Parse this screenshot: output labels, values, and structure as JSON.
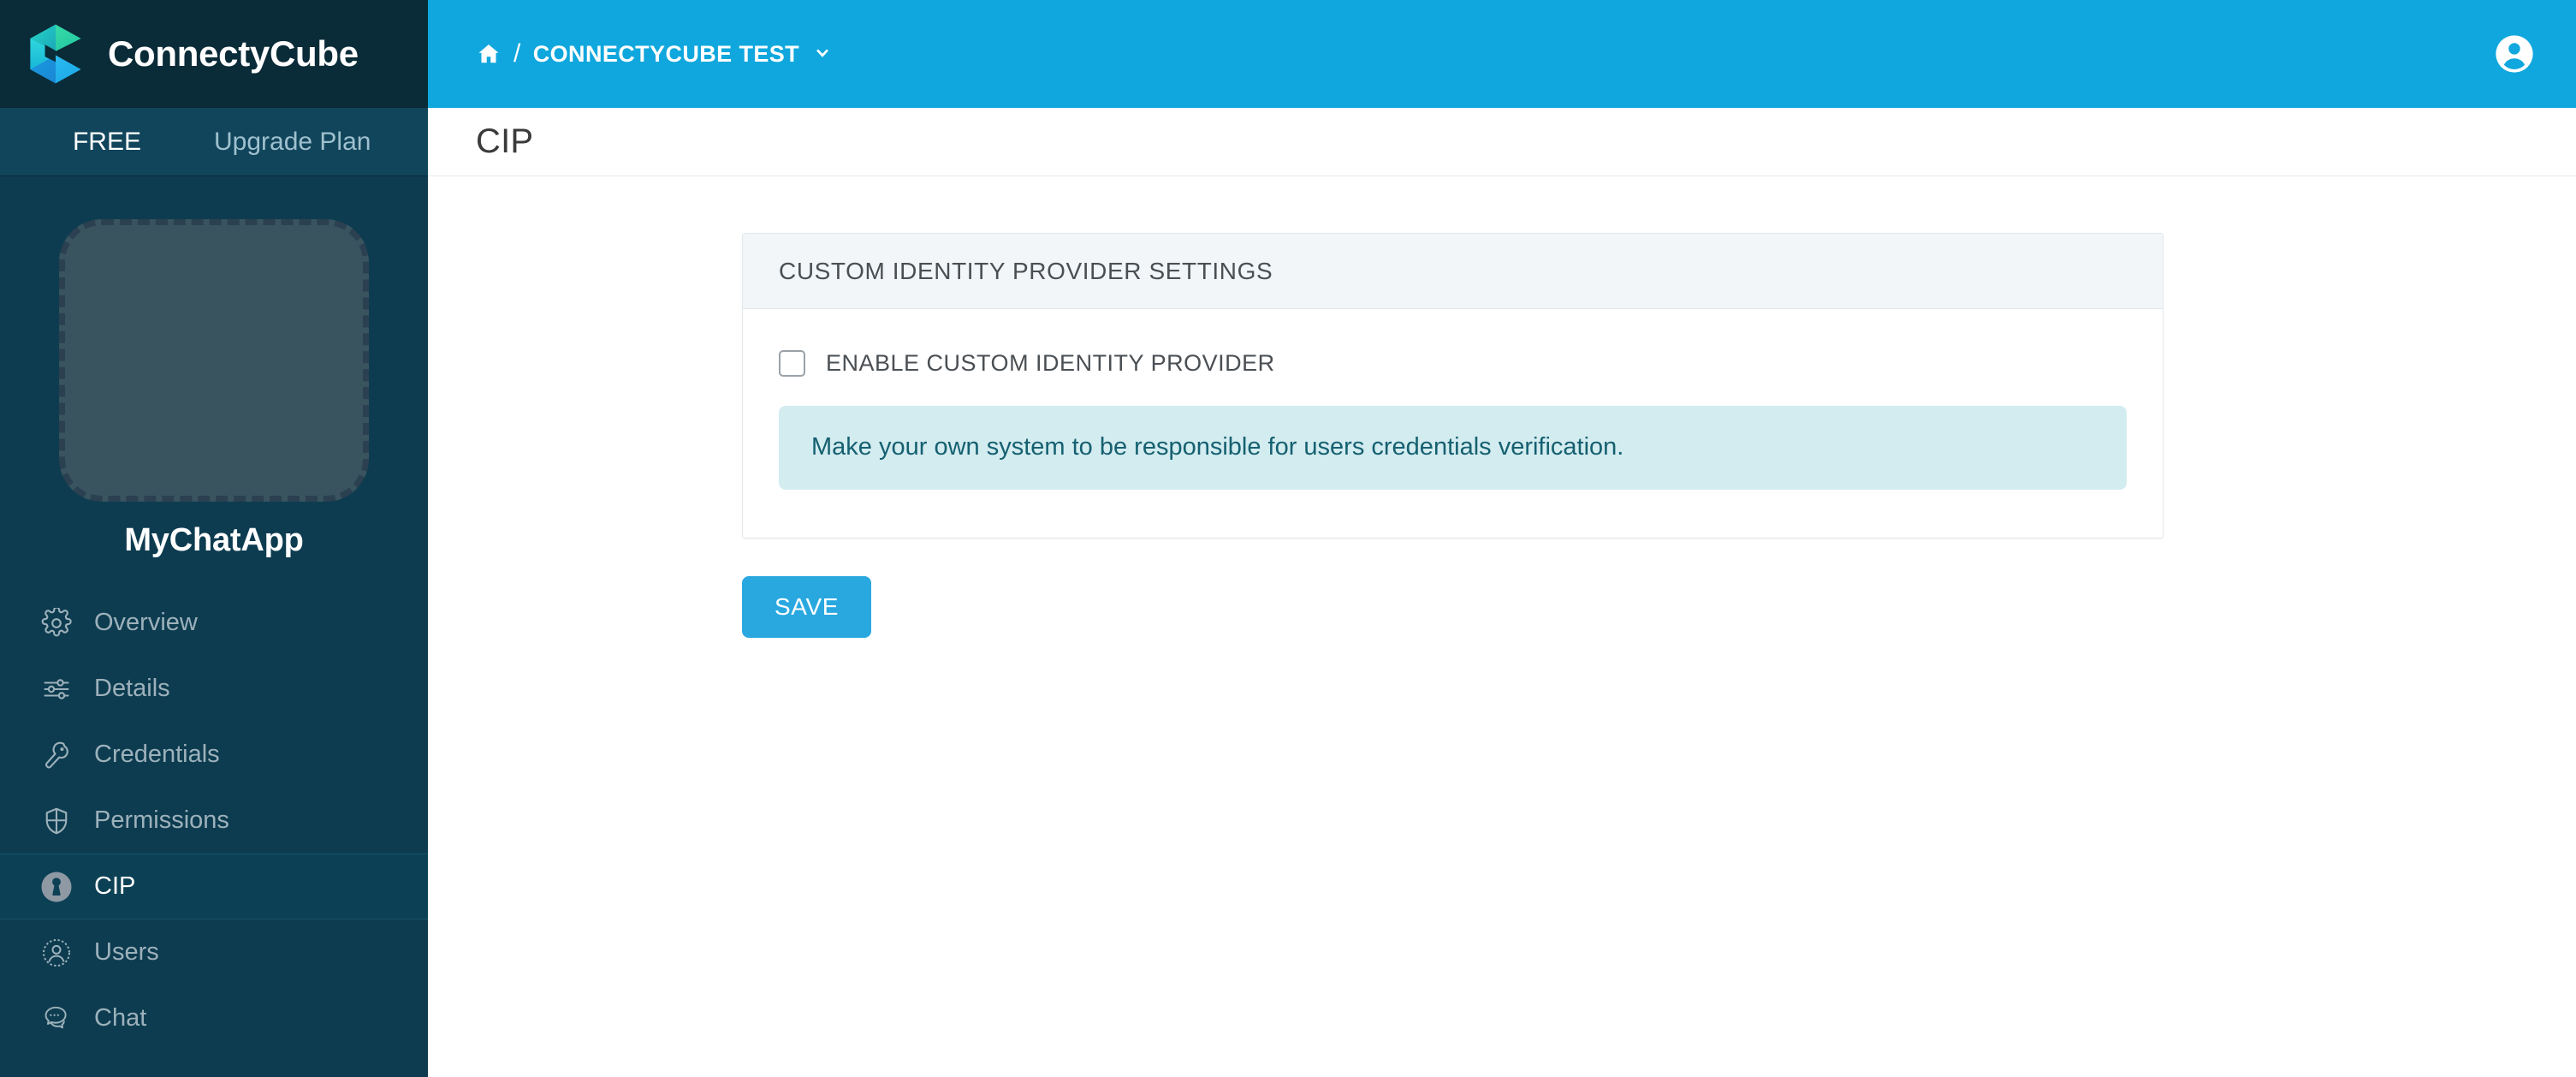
{
  "brand": {
    "name": "ConnectyCube",
    "logo_icon": "connectycube-cube-logo"
  },
  "plan": {
    "tier_label": "FREE",
    "upgrade_label": "Upgrade Plan"
  },
  "app": {
    "avatar_icon": "app-avatar-placeholder",
    "name": "MyChatApp"
  },
  "sidebar": {
    "items": [
      {
        "label": "Overview",
        "icon": "gear-icon",
        "active": false
      },
      {
        "label": "Details",
        "icon": "sliders-icon",
        "active": false
      },
      {
        "label": "Credentials",
        "icon": "key-icon",
        "active": false
      },
      {
        "label": "Permissions",
        "icon": "shield-icon",
        "active": false
      },
      {
        "label": "CIP",
        "icon": "keyhole-icon",
        "active": true
      },
      {
        "label": "Users",
        "icon": "user-icon",
        "active": false
      },
      {
        "label": "Chat",
        "icon": "chat-bubble-icon",
        "active": false
      }
    ]
  },
  "topbar": {
    "home_icon": "home-icon",
    "separator": "/",
    "project_label": "CONNECTYCUBE TEST",
    "caret_icon": "chevron-down-icon",
    "account_icon": "account-circle-icon"
  },
  "page": {
    "title": "CIP"
  },
  "card": {
    "header_title": "CUSTOM IDENTITY PROVIDER SETTINGS",
    "checkbox": {
      "label": "ENABLE CUSTOM IDENTITY PROVIDER",
      "checked": false
    },
    "info_text": "Make your own system to be responsible for users credentials verification."
  },
  "actions": {
    "save_label": "SAVE"
  },
  "colors": {
    "accent_blue": "#0fa7dd",
    "button_blue": "#29a8e0",
    "sidebar_bg": "#0d3c50",
    "brand_bg": "#0a2b38",
    "plan_bar_bg": "#11455b",
    "active_item_bg": "#0c4055",
    "info_banner_bg": "#d3ecf0",
    "info_banner_text": "#156070",
    "card_header_bg": "#f2f6f8"
  }
}
